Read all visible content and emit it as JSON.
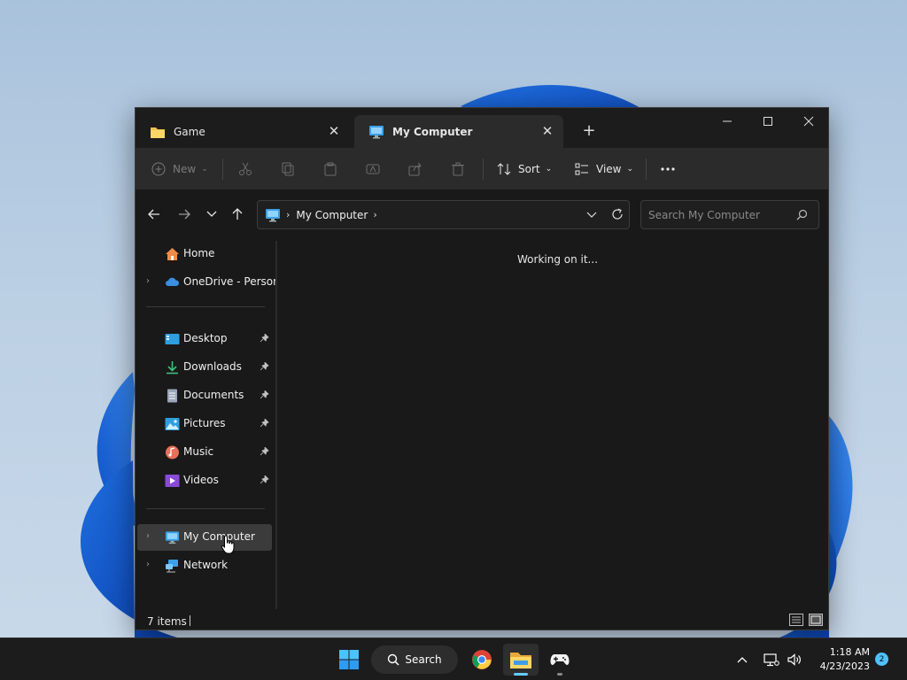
{
  "tabs": [
    {
      "label": "Game",
      "icon": "folder-icon",
      "active": false
    },
    {
      "label": "My Computer",
      "icon": "monitor-icon",
      "active": true
    }
  ],
  "toolbar": {
    "new_label": "New",
    "sort_label": "Sort",
    "view_label": "View"
  },
  "address": {
    "location": "My Computer",
    "search_placeholder": "Search My Computer"
  },
  "sidebar": {
    "top_items": [
      {
        "label": "Home",
        "icon": "home-icon"
      },
      {
        "label": "OneDrive - Personal",
        "icon": "cloud-icon"
      }
    ],
    "pinned_items": [
      {
        "label": "Desktop",
        "icon": "desktop-icon"
      },
      {
        "label": "Downloads",
        "icon": "download-icon"
      },
      {
        "label": "Documents",
        "icon": "document-icon"
      },
      {
        "label": "Pictures",
        "icon": "pictures-icon"
      },
      {
        "label": "Music",
        "icon": "music-icon"
      },
      {
        "label": "Videos",
        "icon": "video-icon"
      }
    ],
    "bottom_items": [
      {
        "label": "My Computer",
        "icon": "monitor-icon",
        "selected": true
      },
      {
        "label": "Network",
        "icon": "network-icon"
      }
    ]
  },
  "content": {
    "status_message": "Working on it..."
  },
  "statusbar": {
    "item_count": "7 items"
  },
  "taskbar": {
    "search_label": "Search",
    "time": "1:18 AM",
    "date": "4/23/2023",
    "notification_count": "2"
  },
  "colors": {
    "accent": "#60cdff",
    "window_bg": "#191919",
    "toolbar_bg": "#2b2b2b",
    "selected_bg": "#3b3b3b"
  }
}
